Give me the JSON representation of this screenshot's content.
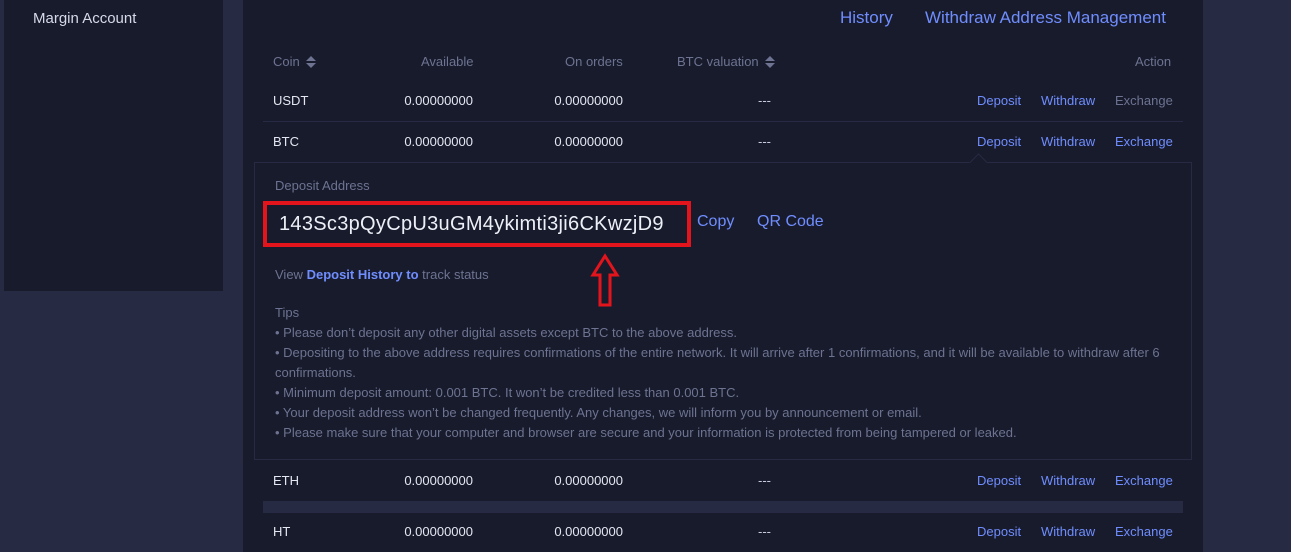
{
  "sidebar": {
    "items": [
      {
        "label": "Margin Account"
      }
    ]
  },
  "header": {
    "history": "History",
    "withdraw_address_management": "Withdraw Address Management"
  },
  "table": {
    "columns": {
      "coin": "Coin",
      "available": "Available",
      "on_orders": "On orders",
      "btc_valuation": "BTC valuation",
      "action": "Action"
    },
    "rows": [
      {
        "coin": "USDT",
        "available": "0.00000000",
        "on_orders": "0.00000000",
        "btc_valuation": "---",
        "deposit": "Deposit",
        "withdraw": "Withdraw",
        "exchange": "Exchange",
        "exchange_enabled": false
      },
      {
        "coin": "BTC",
        "available": "0.00000000",
        "on_orders": "0.00000000",
        "btc_valuation": "---",
        "deposit": "Deposit",
        "withdraw": "Withdraw",
        "exchange": "Exchange",
        "exchange_enabled": true
      },
      {
        "coin": "ETH",
        "available": "0.00000000",
        "on_orders": "0.00000000",
        "btc_valuation": "---",
        "deposit": "Deposit",
        "withdraw": "Withdraw",
        "exchange": "Exchange",
        "exchange_enabled": true
      },
      {
        "coin": "HT",
        "available": "0.00000000",
        "on_orders": "0.00000000",
        "btc_valuation": "---",
        "deposit": "Deposit",
        "withdraw": "Withdraw",
        "exchange": "Exchange",
        "exchange_enabled": true
      }
    ]
  },
  "deposit_panel": {
    "label": "Deposit Address",
    "address": "143Sc3pQyCpU3uGM4ykimti3ji6CKwzjD9",
    "copy": "Copy",
    "qr_code": "QR Code",
    "history_prefix": "View",
    "history_link": "Deposit History to",
    "history_suffix": "track status",
    "tips_title": "Tips",
    "tips": [
      "• Please don’t deposit any other digital assets except BTC to the above address.",
      "• Depositing to the above address requires confirmations of the entire network. It will arrive after 1 confirmations, and it will be available to withdraw after 6 confirmations.",
      "• Minimum deposit amount: 0.001 BTC. It won’t be credited less than 0.001 BTC.",
      "• Your deposit address won’t be changed frequently. Any changes, we will inform you by announcement or email.",
      "• Please make sure that your computer and browser are secure and your information is protected from being tampered or leaked."
    ]
  },
  "colors": {
    "accent": "#6f8dff",
    "highlight": "#e3141c",
    "panel_bg": "#181b2c",
    "page_bg": "#262a42"
  }
}
